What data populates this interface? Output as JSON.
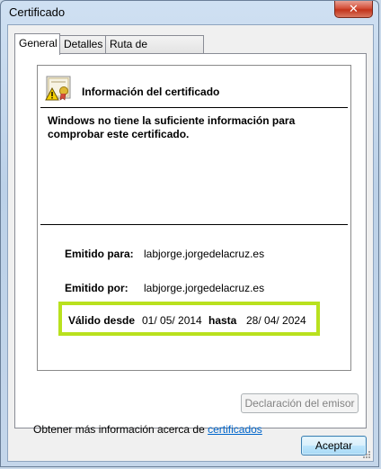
{
  "window": {
    "title": "Certificado",
    "close_symbol": "✕"
  },
  "tabs": [
    {
      "label": "General"
    },
    {
      "label": "Detalles"
    },
    {
      "label": "Ruta de certificación"
    }
  ],
  "cert": {
    "header": "Información del certificado",
    "warning": "Windows no tiene la suficiente información para comprobar este certificado.",
    "issued_to_label": "Emitido para:",
    "issued_to_value": "labjorge.jorgedelacruz.es",
    "issued_by_label": "Emitido por:",
    "issued_by_value": "labjorge.jorgedelacruz.es",
    "valid_from_label": "Válido desde",
    "valid_from_value": "01/ 05/ 2014",
    "valid_to_label": "hasta",
    "valid_to_value": "28/ 04/ 2024"
  },
  "issuer_statement_label": "Declaración del emisor",
  "more_info_text": "Obtener más información acerca de",
  "more_info_link": "certificados",
  "accept_label": "Aceptar",
  "colors": {
    "highlight": "#b9e11e",
    "link": "#0066cc",
    "close": "#c2341b"
  }
}
